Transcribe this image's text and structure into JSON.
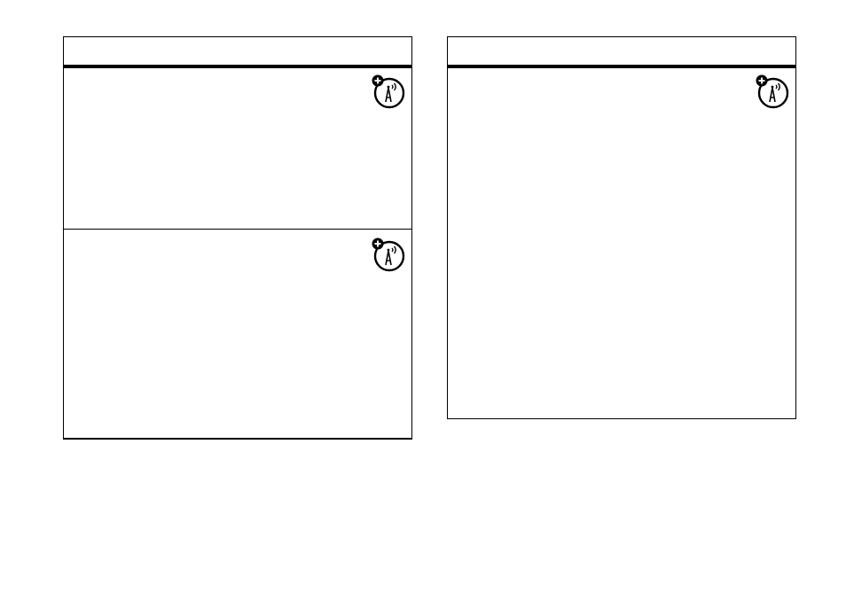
{
  "panels": [
    {
      "header": "",
      "rows": [
        {
          "text": "",
          "icon": "network-feature-icon"
        },
        {
          "text": "",
          "icon": "network-feature-icon"
        }
      ]
    },
    {
      "header": "",
      "rows": [
        {
          "text": "",
          "icon": "network-feature-icon"
        }
      ]
    }
  ]
}
